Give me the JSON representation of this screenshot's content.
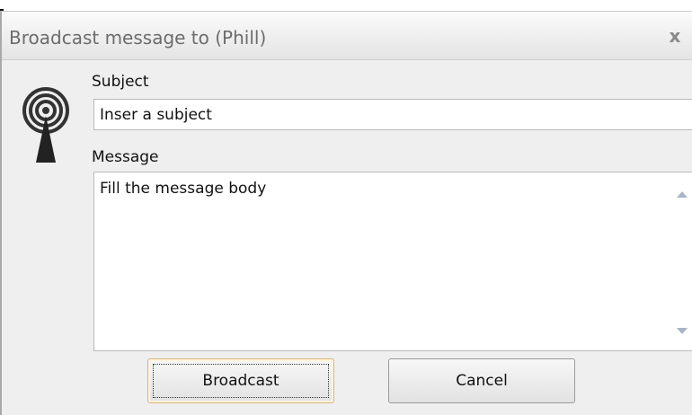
{
  "window": {
    "title": "Broadcast message to (Phill)",
    "close_glyph": "x"
  },
  "icon": "broadcast-antenna-icon",
  "form": {
    "subject_label": "Subject",
    "subject_value": "Inser a subject",
    "message_label": "Message",
    "message_value": "Fill the message body"
  },
  "buttons": {
    "broadcast": "Broadcast",
    "cancel": "Cancel"
  }
}
